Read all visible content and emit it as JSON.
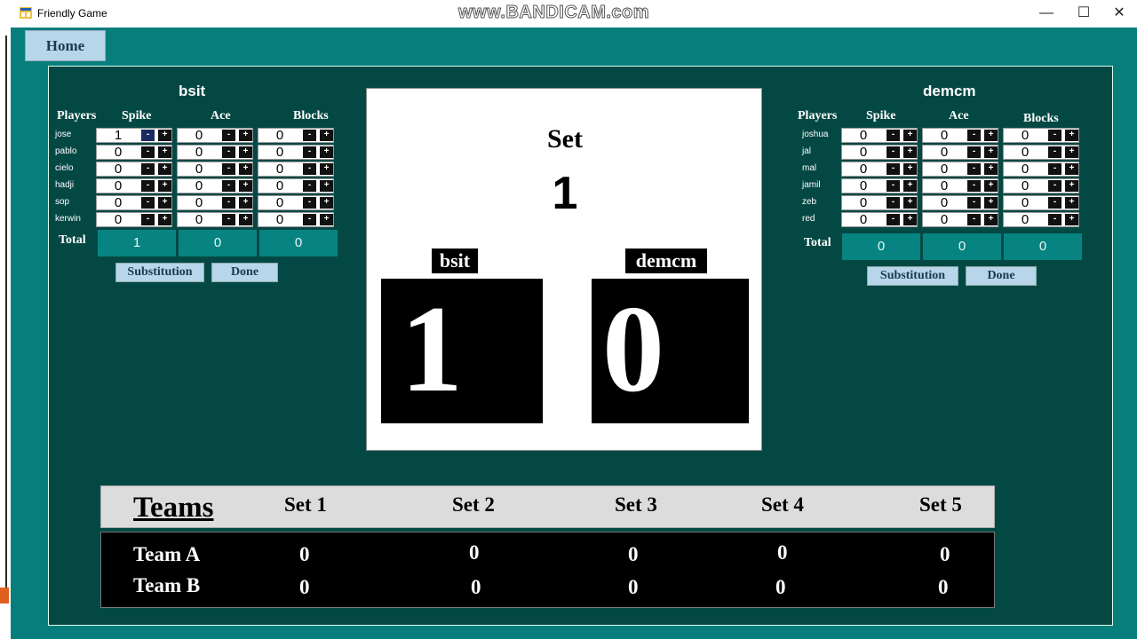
{
  "window": {
    "title": "Friendly Game",
    "watermark": "www.BANDICAM.com",
    "min": "—",
    "max": "☐",
    "close": "✕"
  },
  "nav": {
    "home_label": "Home"
  },
  "team_a": {
    "name": "bsit",
    "headers": {
      "players": "Players",
      "spike": "Spike",
      "ace": "Ace",
      "blocks": "Blocks"
    },
    "players": [
      {
        "name": "jose",
        "spike": "1",
        "ace": "0",
        "blocks": "0"
      },
      {
        "name": "pablo",
        "spike": "0",
        "ace": "0",
        "blocks": "0"
      },
      {
        "name": "cielo",
        "spike": "0",
        "ace": "0",
        "blocks": "0"
      },
      {
        "name": "hadji",
        "spike": "0",
        "ace": "0",
        "blocks": "0"
      },
      {
        "name": "sop",
        "spike": "0",
        "ace": "0",
        "blocks": "0"
      },
      {
        "name": "kerwin",
        "spike": "0",
        "ace": "0",
        "blocks": "0"
      }
    ],
    "total_label": "Total",
    "totals": {
      "spike": "1",
      "ace": "0",
      "blocks": "0"
    },
    "substitution_label": "Substitution",
    "done_label": "Done"
  },
  "team_b": {
    "name": "demcm",
    "headers": {
      "players": "Players",
      "spike": "Spike",
      "ace": "Ace",
      "blocks": "Blocks"
    },
    "players": [
      {
        "name": "joshua",
        "spike": "0",
        "ace": "0",
        "blocks": "0"
      },
      {
        "name": "jal",
        "spike": "0",
        "ace": "0",
        "blocks": "0"
      },
      {
        "name": "mal",
        "spike": "0",
        "ace": "0",
        "blocks": "0"
      },
      {
        "name": "jamil",
        "spike": "0",
        "ace": "0",
        "blocks": "0"
      },
      {
        "name": "zeb",
        "spike": "0",
        "ace": "0",
        "blocks": "0"
      },
      {
        "name": "red",
        "spike": "0",
        "ace": "0",
        "blocks": "0"
      }
    ],
    "total_label": "Total",
    "totals": {
      "spike": "0",
      "ace": "0",
      "blocks": "0"
    },
    "substitution_label": "Substitution",
    "done_label": "Done"
  },
  "scoreboard": {
    "set_label": "Set",
    "set_number": "1",
    "team_a": "bsit",
    "team_b": "demcm",
    "score_a": "1",
    "score_b": "0"
  },
  "sets_table": {
    "teams_label": "Teams",
    "headers": [
      "Set 1",
      "Set 2",
      "Set 3",
      "Set 4",
      "Set 5"
    ],
    "rows": [
      {
        "team": "Team A",
        "values": [
          "0",
          "0",
          "0",
          "0",
          "0"
        ]
      },
      {
        "team": "Team B",
        "values": [
          "0",
          "0",
          "0",
          "0",
          "0"
        ]
      }
    ]
  },
  "stepper": {
    "minus": "-",
    "plus": "+"
  },
  "colors": {
    "form_bg": "#077e7c",
    "panel_bg": "#044844",
    "button_bg": "#b8d6e9",
    "total_bg": "#078481"
  }
}
